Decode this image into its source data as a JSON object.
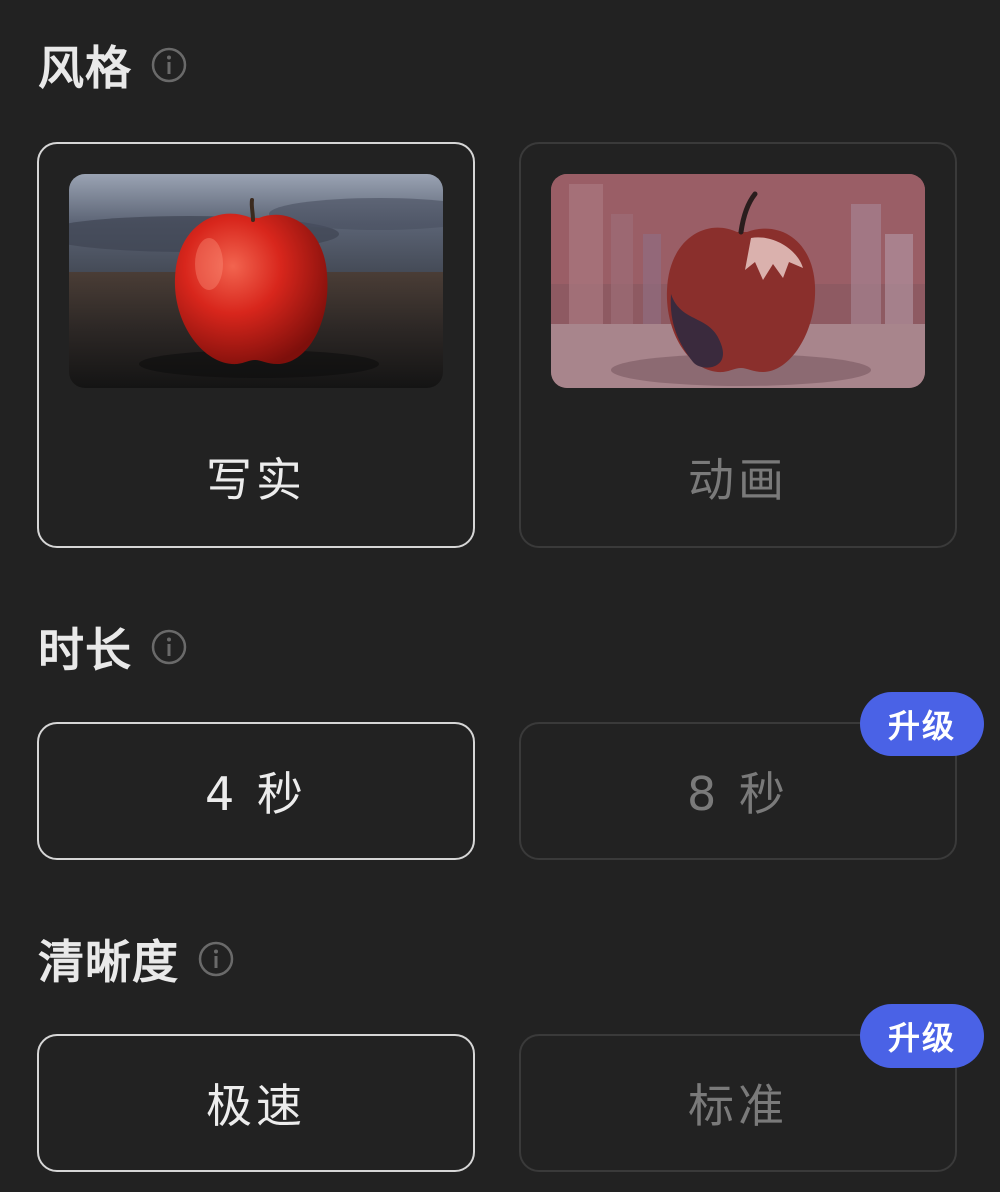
{
  "colors": {
    "background": "#222222",
    "selected_border": "#d6d6d6",
    "unselected_border": "#3a3a3a",
    "badge": "#4a62e6"
  },
  "sections": {
    "style": {
      "title": "风格",
      "info_icon": "info-circle-icon",
      "options": [
        {
          "label": "写实",
          "selected": true,
          "thumbnail": "realistic-apple-image"
        },
        {
          "label": "动画",
          "selected": false,
          "thumbnail": "anime-apple-image"
        }
      ]
    },
    "duration": {
      "title": "时长",
      "info_icon": "info-circle-icon",
      "options": [
        {
          "label": "4 秒",
          "selected": true
        },
        {
          "label": "8 秒",
          "selected": false,
          "badge": "升级"
        }
      ]
    },
    "resolution": {
      "title": "清晰度",
      "info_icon": "info-circle-icon",
      "options": [
        {
          "label": "极速",
          "selected": true
        },
        {
          "label": "标准",
          "selected": false,
          "badge": "升级"
        }
      ]
    }
  }
}
